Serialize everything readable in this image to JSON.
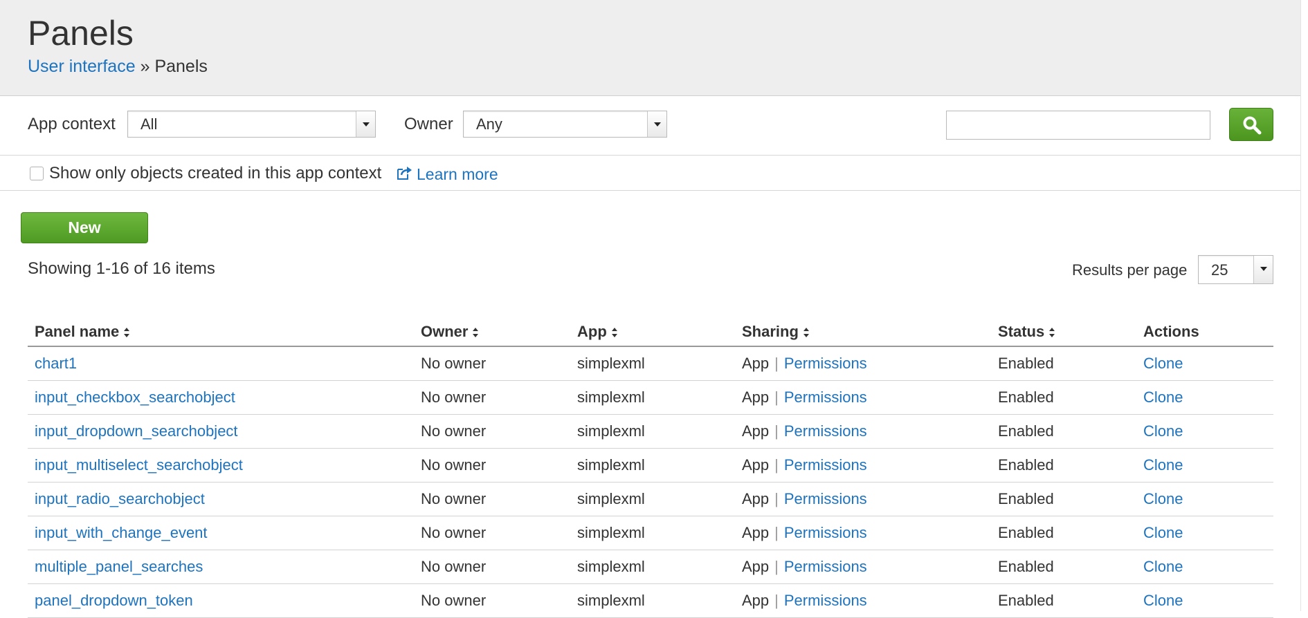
{
  "header": {
    "title": "Panels",
    "breadcrumb": {
      "parent": "User interface",
      "separator": "»",
      "current": "Panels"
    }
  },
  "filters": {
    "app_context_label": "App context",
    "app_context_value": "All",
    "owner_label": "Owner",
    "owner_value": "Any",
    "search_value": ""
  },
  "options": {
    "checkbox_label": "Show only objects created in this app context",
    "checkbox_checked": false,
    "learn_more": "Learn more"
  },
  "toolbar": {
    "new_label": "New",
    "showing_text": "Showing 1-16 of 16 items",
    "results_per_page_label": "Results per page",
    "results_per_page_value": "25"
  },
  "table": {
    "columns": [
      "Panel name",
      "Owner",
      "App",
      "Sharing",
      "Status",
      "Actions"
    ],
    "sharing_link": "Permissions",
    "action_link": "Clone",
    "rows": [
      {
        "name": "chart1",
        "owner": "No owner",
        "app": "simplexml",
        "sharing": "App",
        "status": "Enabled"
      },
      {
        "name": "input_checkbox_searchobject",
        "owner": "No owner",
        "app": "simplexml",
        "sharing": "App",
        "status": "Enabled"
      },
      {
        "name": "input_dropdown_searchobject",
        "owner": "No owner",
        "app": "simplexml",
        "sharing": "App",
        "status": "Enabled"
      },
      {
        "name": "input_multiselect_searchobject",
        "owner": "No owner",
        "app": "simplexml",
        "sharing": "App",
        "status": "Enabled"
      },
      {
        "name": "input_radio_searchobject",
        "owner": "No owner",
        "app": "simplexml",
        "sharing": "App",
        "status": "Enabled"
      },
      {
        "name": "input_with_change_event",
        "owner": "No owner",
        "app": "simplexml",
        "sharing": "App",
        "status": "Enabled"
      },
      {
        "name": "multiple_panel_searches",
        "owner": "No owner",
        "app": "simplexml",
        "sharing": "App",
        "status": "Enabled"
      },
      {
        "name": "panel_dropdown_token",
        "owner": "No owner",
        "app": "simplexml",
        "sharing": "App",
        "status": "Enabled"
      }
    ]
  },
  "colors": {
    "link": "#1e73be",
    "accent_green": "#5aa52c",
    "header_bg": "#eeeeee"
  },
  "icons": {
    "search": "magnifier-icon",
    "learn_more": "external-link-icon",
    "sort": "sort-arrows-icon"
  }
}
